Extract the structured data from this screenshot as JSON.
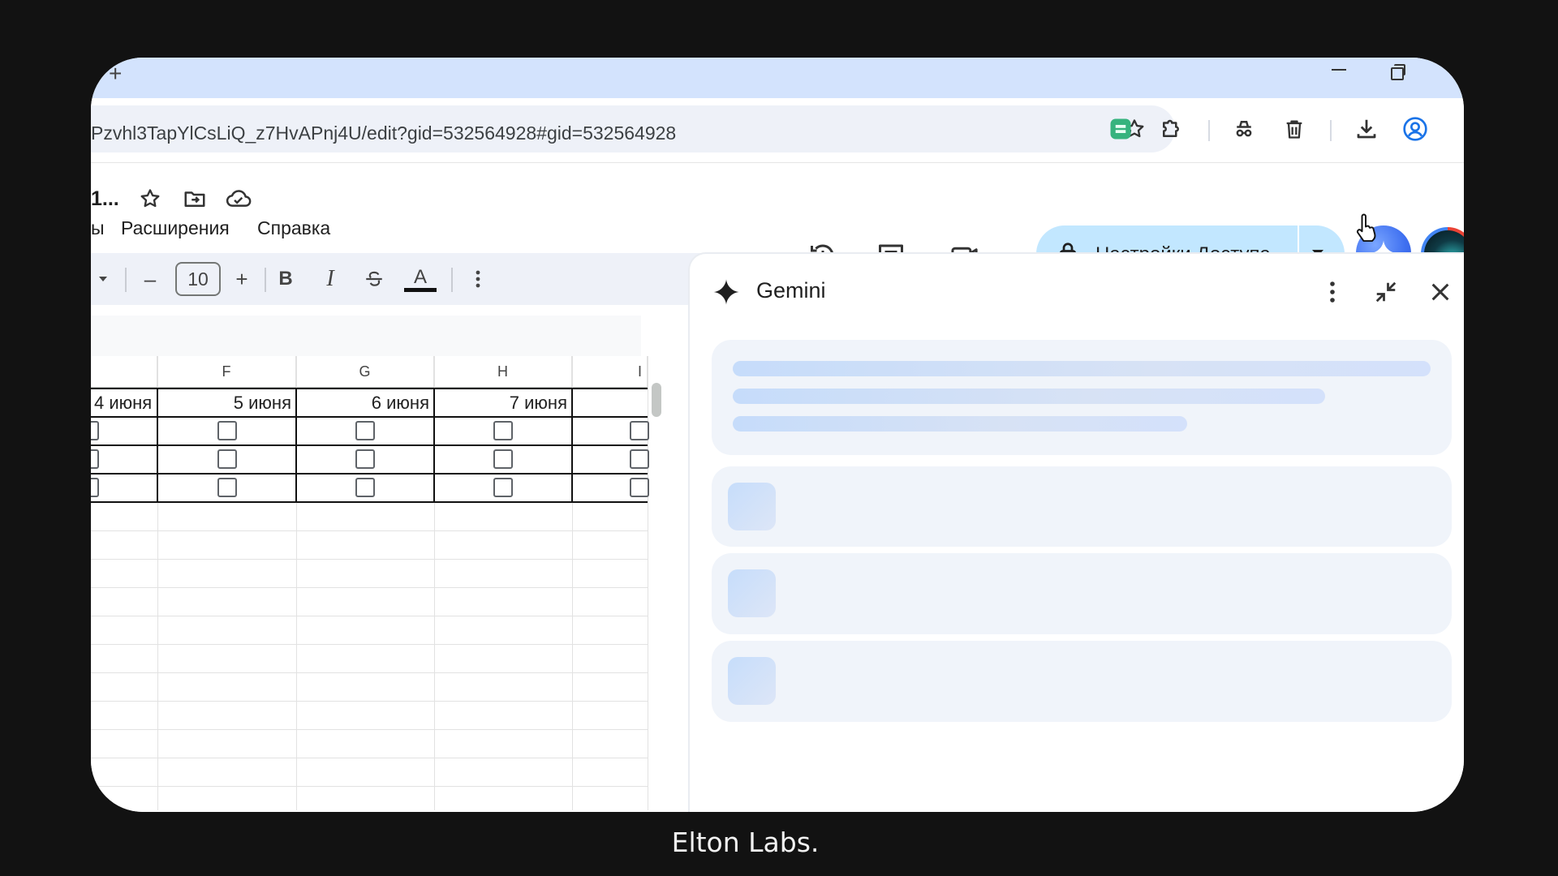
{
  "browser": {
    "url": "Pzvhl3TapYlCsLiQ_z7HvAPnj4U/edit?gid=532564928#gid=532564928",
    "new_tab_glyph": "+",
    "icons": [
      "star-icon",
      "extension-green-icon",
      "puzzle-icon",
      "incognito-icon",
      "trash-icon",
      "download-icon",
      "profile-icon"
    ]
  },
  "document": {
    "title_fragment": "1...",
    "menus": [
      "ы",
      "Расширения",
      "Справка"
    ],
    "share_label": "Настройки Доступа"
  },
  "format_toolbar": {
    "font_size": "10",
    "minus": "–",
    "plus": "+",
    "bold": "B",
    "italic": "I",
    "text_color": "A"
  },
  "sheet": {
    "columns": [
      "F",
      "G",
      "H",
      "I"
    ],
    "dates": [
      "4 июня",
      "5 июня",
      "6 июня",
      "7 июня"
    ],
    "checkbox_rows": 3
  },
  "gemini": {
    "title": "Gemini",
    "state": "loading"
  },
  "caption": "Elton Labs.",
  "colors": {
    "tab_strip": "#d3e3fd",
    "share_button": "#c2e7ff",
    "skeleton_card": "#f0f4fa",
    "page_background": "#121212"
  }
}
